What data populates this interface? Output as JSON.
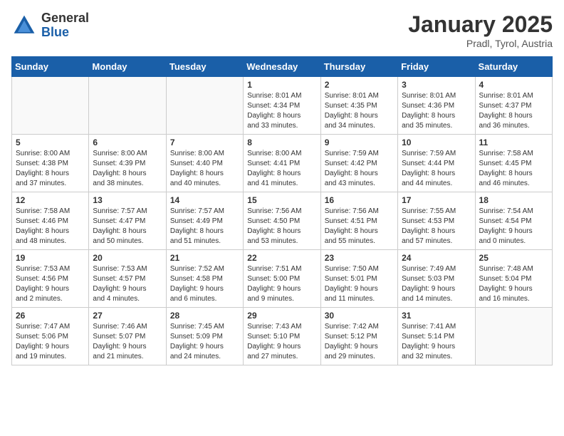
{
  "header": {
    "logo_general": "General",
    "logo_blue": "Blue",
    "month_title": "January 2025",
    "location": "Pradl, Tyrol, Austria"
  },
  "weekdays": [
    "Sunday",
    "Monday",
    "Tuesday",
    "Wednesday",
    "Thursday",
    "Friday",
    "Saturday"
  ],
  "weeks": [
    [
      {
        "day": "",
        "info": ""
      },
      {
        "day": "",
        "info": ""
      },
      {
        "day": "",
        "info": ""
      },
      {
        "day": "1",
        "info": "Sunrise: 8:01 AM\nSunset: 4:34 PM\nDaylight: 8 hours\nand 33 minutes."
      },
      {
        "day": "2",
        "info": "Sunrise: 8:01 AM\nSunset: 4:35 PM\nDaylight: 8 hours\nand 34 minutes."
      },
      {
        "day": "3",
        "info": "Sunrise: 8:01 AM\nSunset: 4:36 PM\nDaylight: 8 hours\nand 35 minutes."
      },
      {
        "day": "4",
        "info": "Sunrise: 8:01 AM\nSunset: 4:37 PM\nDaylight: 8 hours\nand 36 minutes."
      }
    ],
    [
      {
        "day": "5",
        "info": "Sunrise: 8:00 AM\nSunset: 4:38 PM\nDaylight: 8 hours\nand 37 minutes."
      },
      {
        "day": "6",
        "info": "Sunrise: 8:00 AM\nSunset: 4:39 PM\nDaylight: 8 hours\nand 38 minutes."
      },
      {
        "day": "7",
        "info": "Sunrise: 8:00 AM\nSunset: 4:40 PM\nDaylight: 8 hours\nand 40 minutes."
      },
      {
        "day": "8",
        "info": "Sunrise: 8:00 AM\nSunset: 4:41 PM\nDaylight: 8 hours\nand 41 minutes."
      },
      {
        "day": "9",
        "info": "Sunrise: 7:59 AM\nSunset: 4:42 PM\nDaylight: 8 hours\nand 43 minutes."
      },
      {
        "day": "10",
        "info": "Sunrise: 7:59 AM\nSunset: 4:44 PM\nDaylight: 8 hours\nand 44 minutes."
      },
      {
        "day": "11",
        "info": "Sunrise: 7:58 AM\nSunset: 4:45 PM\nDaylight: 8 hours\nand 46 minutes."
      }
    ],
    [
      {
        "day": "12",
        "info": "Sunrise: 7:58 AM\nSunset: 4:46 PM\nDaylight: 8 hours\nand 48 minutes."
      },
      {
        "day": "13",
        "info": "Sunrise: 7:57 AM\nSunset: 4:47 PM\nDaylight: 8 hours\nand 50 minutes."
      },
      {
        "day": "14",
        "info": "Sunrise: 7:57 AM\nSunset: 4:49 PM\nDaylight: 8 hours\nand 51 minutes."
      },
      {
        "day": "15",
        "info": "Sunrise: 7:56 AM\nSunset: 4:50 PM\nDaylight: 8 hours\nand 53 minutes."
      },
      {
        "day": "16",
        "info": "Sunrise: 7:56 AM\nSunset: 4:51 PM\nDaylight: 8 hours\nand 55 minutes."
      },
      {
        "day": "17",
        "info": "Sunrise: 7:55 AM\nSunset: 4:53 PM\nDaylight: 8 hours\nand 57 minutes."
      },
      {
        "day": "18",
        "info": "Sunrise: 7:54 AM\nSunset: 4:54 PM\nDaylight: 9 hours\nand 0 minutes."
      }
    ],
    [
      {
        "day": "19",
        "info": "Sunrise: 7:53 AM\nSunset: 4:56 PM\nDaylight: 9 hours\nand 2 minutes."
      },
      {
        "day": "20",
        "info": "Sunrise: 7:53 AM\nSunset: 4:57 PM\nDaylight: 9 hours\nand 4 minutes."
      },
      {
        "day": "21",
        "info": "Sunrise: 7:52 AM\nSunset: 4:58 PM\nDaylight: 9 hours\nand 6 minutes."
      },
      {
        "day": "22",
        "info": "Sunrise: 7:51 AM\nSunset: 5:00 PM\nDaylight: 9 hours\nand 9 minutes."
      },
      {
        "day": "23",
        "info": "Sunrise: 7:50 AM\nSunset: 5:01 PM\nDaylight: 9 hours\nand 11 minutes."
      },
      {
        "day": "24",
        "info": "Sunrise: 7:49 AM\nSunset: 5:03 PM\nDaylight: 9 hours\nand 14 minutes."
      },
      {
        "day": "25",
        "info": "Sunrise: 7:48 AM\nSunset: 5:04 PM\nDaylight: 9 hours\nand 16 minutes."
      }
    ],
    [
      {
        "day": "26",
        "info": "Sunrise: 7:47 AM\nSunset: 5:06 PM\nDaylight: 9 hours\nand 19 minutes."
      },
      {
        "day": "27",
        "info": "Sunrise: 7:46 AM\nSunset: 5:07 PM\nDaylight: 9 hours\nand 21 minutes."
      },
      {
        "day": "28",
        "info": "Sunrise: 7:45 AM\nSunset: 5:09 PM\nDaylight: 9 hours\nand 24 minutes."
      },
      {
        "day": "29",
        "info": "Sunrise: 7:43 AM\nSunset: 5:10 PM\nDaylight: 9 hours\nand 27 minutes."
      },
      {
        "day": "30",
        "info": "Sunrise: 7:42 AM\nSunset: 5:12 PM\nDaylight: 9 hours\nand 29 minutes."
      },
      {
        "day": "31",
        "info": "Sunrise: 7:41 AM\nSunset: 5:14 PM\nDaylight: 9 hours\nand 32 minutes."
      },
      {
        "day": "",
        "info": ""
      }
    ]
  ]
}
